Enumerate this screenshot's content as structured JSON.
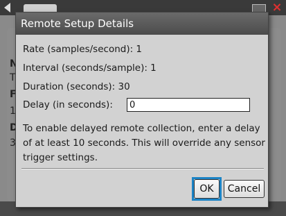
{
  "dialog": {
    "title": "Remote Setup Details",
    "rate_label": "Rate (samples/second): 1",
    "interval_label": "Interval (seconds/sample): 1",
    "duration_label": "Duration (seconds):  30",
    "delay_label": "Delay (in seconds):",
    "delay_value": "0",
    "note": "To enable delayed remote collection, enter a delay of at least 10 seconds.  This will override any sensor trigger settings.",
    "ok_label": "OK",
    "cancel_label": "Cancel"
  },
  "background": {
    "close_glyph": "×",
    "sidebar_letters": [
      "N",
      "T",
      "F",
      "1",
      "D",
      "3"
    ]
  }
}
